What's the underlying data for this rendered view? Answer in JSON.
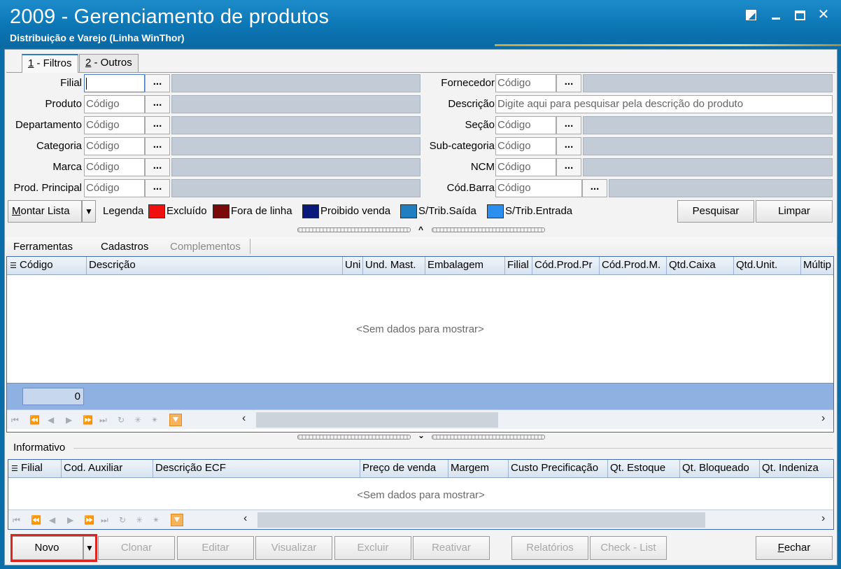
{
  "window": {
    "title": "2009 - Gerenciamento de produtos",
    "subtitle": "Distribuição e Varejo (Linha WinThor)"
  },
  "tabs": [
    {
      "mnemonic": "1",
      "label": " - Filtros"
    },
    {
      "mnemonic": "2",
      "label": " - Outros"
    }
  ],
  "filters": {
    "left": [
      {
        "label": "Filial",
        "value": ""
      },
      {
        "label": "Produto",
        "placeholder": "Código"
      },
      {
        "label": "Departamento",
        "placeholder": "Código"
      },
      {
        "label": "Categoria",
        "placeholder": "Código"
      },
      {
        "label": "Marca",
        "placeholder": "Código"
      },
      {
        "label": "Prod. Principal",
        "placeholder": "Código"
      }
    ],
    "right": [
      {
        "label": "Fornecedor",
        "placeholder": "Código"
      },
      {
        "label": "Descrição",
        "placeholder": "Digite aqui para pesquisar pela descrição do produto"
      },
      {
        "label": "Seção",
        "placeholder": "Código"
      },
      {
        "label": "Sub-categoria",
        "placeholder": "Código"
      },
      {
        "label": "NCM",
        "placeholder": "Código"
      },
      {
        "label": "Cód.Barra",
        "placeholder": "Código"
      }
    ],
    "lookup_label": "..."
  },
  "legend": {
    "montar_lista": "Montar Lista",
    "title": "Legenda",
    "items": [
      {
        "label": "Excluído",
        "color": "#f01010"
      },
      {
        "label": "Fora de linha",
        "color": "#7a0a0a"
      },
      {
        "label": "Proibido venda",
        "color": "#0a1a7a"
      },
      {
        "label": "S/Trib.Saída",
        "color": "#1f7fc0"
      },
      {
        "label": "S/Trib.Entrada",
        "color": "#2a8fee"
      }
    ],
    "pesquisar": "Pesquisar",
    "limpar": "Limpar"
  },
  "menu": {
    "ferramentas": "Ferramentas",
    "cadastros": "Cadastros",
    "complementos": "Complementos"
  },
  "products_grid": {
    "columns": [
      "Código",
      "Descrição",
      "Uni",
      "Und. Mast.",
      "Embalagem",
      "Filial",
      "Cód.Prod.Pr",
      "Cód.Prod.M.",
      "Qtd.Caixa",
      "Qtd.Unit.",
      "Múltip"
    ],
    "empty_text": "<Sem dados para mostrar>",
    "count": "0"
  },
  "informativo": {
    "label": "Informativo",
    "columns": [
      "Filial",
      "Cod. Auxiliar",
      "Descrição ECF",
      "Preço de venda",
      "Margem",
      "Custo Precificação",
      "Qt. Estoque",
      "Qt. Bloqueado",
      "Qt. Indeniza"
    ],
    "empty_text": "<Sem dados para mostrar>"
  },
  "actions": {
    "novo": "Novo",
    "clonar": "Clonar",
    "editar": "Editar",
    "visualizar": "Visualizar",
    "excluir": "Excluir",
    "reativar": "Reativar",
    "relatorios": "Relatórios",
    "checklist": "Check - List",
    "fechar": "Fechar"
  },
  "colors": {
    "titlebar": "#0c76b4",
    "grid_border": "#4169b0",
    "highlight": "#e0241f"
  }
}
